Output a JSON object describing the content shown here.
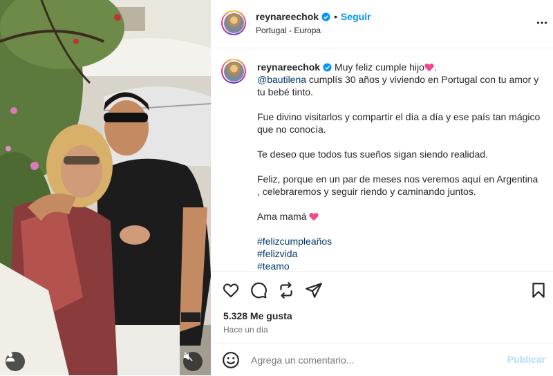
{
  "post": {
    "username": "reynareechok",
    "follow_label": "Seguir",
    "location": "Portugal - Europa",
    "caption": {
      "first_line": "Muy feliz cumple hijo",
      "first_line_end": ".",
      "mention": "@bautilena",
      "mention_rest": " cumplís 30 años y viviendo en Portugal con tu amor y tu bebé tinto.",
      "paragraphs": [
        "Fue divino visitarlos y compartir el día a día y ese país tan mágico que no conocía.",
        "Te deseo que todos tus sueños sigan siendo realidad.",
        "Feliz, porque en un par de meses nos veremos aquí en Argentina\n, celebraremos y seguir riendo y caminando juntos."
      ],
      "sign_off": "Ama mamá",
      "hashtags": [
        "#felizcumpleaños",
        "#felizvida",
        "#teamo"
      ]
    },
    "likes": "5.328 Me gusta",
    "time_ago": "Hace un día"
  },
  "comment": {
    "placeholder": "Agrega un comentario...",
    "post_label": "Publicar"
  },
  "icons": {
    "verified": "verified-badge-icon",
    "more": "more-options-icon",
    "like": "heart-outline-icon",
    "comment": "comment-bubble-icon",
    "share": "repost-icon",
    "send": "send-paper-plane-icon",
    "save": "bookmark-icon",
    "emoji": "smiley-icon",
    "user_tag": "person-icon",
    "mute": "speaker-muted-icon"
  },
  "colors": {
    "link": "#0095f6",
    "hashtag": "#00376b",
    "heart": "#ed4956",
    "publish_disabled": "#b3dbff"
  }
}
